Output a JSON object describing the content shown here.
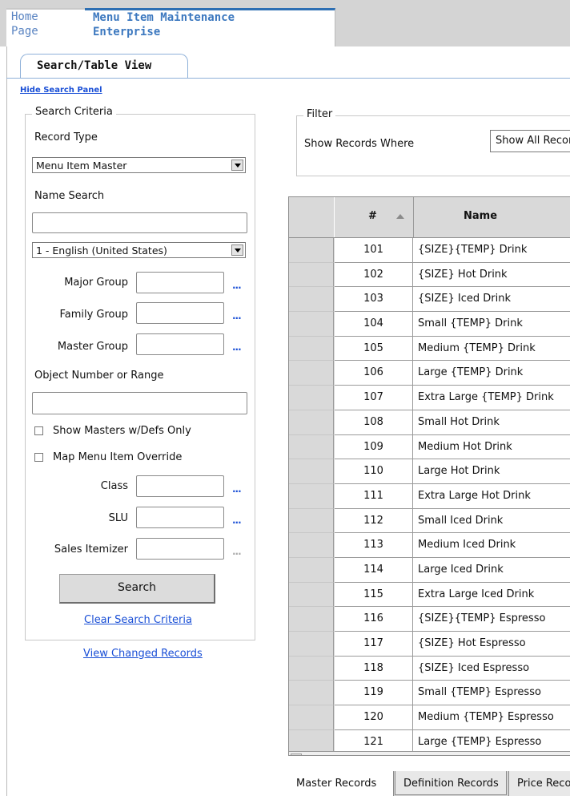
{
  "top_tabs": {
    "home": [
      "Home",
      "Page"
    ],
    "active": [
      "Menu Item Maintenance",
      "Enterprise"
    ]
  },
  "sub_tab": "Search/Table View",
  "hide_search_panel": "Hide Search Panel",
  "search": {
    "legend": "Search Criteria",
    "record_type_label": "Record Type",
    "record_type_value": "Menu Item Master",
    "name_search_label": "Name Search",
    "name_search_value": "",
    "language_value": "1 - English (United States)",
    "major_group_label": "Major Group",
    "family_group_label": "Family Group",
    "master_group_label": "Master Group",
    "object_number_label": "Object Number or Range",
    "show_masters_label": "Show Masters w/Defs Only",
    "map_override_label": "Map Menu Item Override",
    "class_label": "Class",
    "slu_label": "SLU",
    "sales_itemizer_label": "Sales Itemizer",
    "ellipsis": "...",
    "search_button": "Search",
    "clear_link": "Clear Search Criteria"
  },
  "view_changed_records": "View Changed Records",
  "filter": {
    "legend": "Filter",
    "label": "Show Records Where",
    "value": "Show All Records"
  },
  "grid": {
    "columns": [
      "#",
      "Name"
    ],
    "rows": [
      {
        "num": "101",
        "name": "{SIZE}{TEMP} Drink"
      },
      {
        "num": "102",
        "name": "{SIZE} Hot Drink"
      },
      {
        "num": "103",
        "name": "{SIZE} Iced Drink"
      },
      {
        "num": "104",
        "name": "Small {TEMP} Drink"
      },
      {
        "num": "105",
        "name": "Medium {TEMP} Drink"
      },
      {
        "num": "106",
        "name": "Large {TEMP} Drink"
      },
      {
        "num": "107",
        "name": "Extra Large {TEMP} Drink"
      },
      {
        "num": "108",
        "name": "Small Hot Drink"
      },
      {
        "num": "109",
        "name": "Medium Hot Drink"
      },
      {
        "num": "110",
        "name": "Large Hot Drink"
      },
      {
        "num": "111",
        "name": "Extra Large Hot Drink"
      },
      {
        "num": "112",
        "name": "Small Iced Drink"
      },
      {
        "num": "113",
        "name": "Medium Iced Drink"
      },
      {
        "num": "114",
        "name": "Large Iced Drink"
      },
      {
        "num": "115",
        "name": "Extra Large Iced Drink"
      },
      {
        "num": "116",
        "name": "{SIZE}{TEMP} Espresso"
      },
      {
        "num": "117",
        "name": "{SIZE} Hot Espresso"
      },
      {
        "num": "118",
        "name": "{SIZE} Iced Espresso"
      },
      {
        "num": "119",
        "name": "Small {TEMP} Espresso"
      },
      {
        "num": "120",
        "name": "Medium {TEMP} Espresso"
      },
      {
        "num": "121",
        "name": "Large {TEMP} Espresso"
      }
    ]
  },
  "bottom_tabs": [
    "Master Records",
    "Definition Records",
    "Price Records"
  ],
  "colors": {
    "accent_blue": "#2e6fb3",
    "link_blue": "#1a4fd6",
    "chrome_gray": "#d4d4d4"
  }
}
